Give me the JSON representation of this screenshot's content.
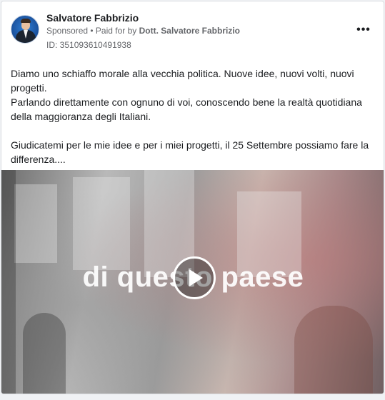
{
  "post": {
    "author": "Salvatore Fabbrizio",
    "sponsored": "Sponsored",
    "paid_for_prefix": " • Paid for by ",
    "paid_for_by": "Dott. Salvatore Fabbrizio",
    "ad_id": "ID: 351093610491938",
    "more_icon": "•••",
    "text_lines": [
      "Diamo uno schiaffo morale alla vecchia politica. Nuove idee, nuovi volti, nuovi progetti.",
      "Parlando direttamente con ognuno di voi, conoscendo bene la realtà quotidiana della maggioranza degli Italiani.",
      "Giudicatemi per le mie idee e per i miei progetti, il 25 Settembre possiamo fare la differenza...."
    ]
  },
  "video": {
    "overlay_text": "di questo paese",
    "play_icon": "play-icon"
  },
  "icons": [
    "more-options-icon",
    "play-icon"
  ],
  "colors": {
    "text": "#1c1e21",
    "secondary": "#65676b",
    "border": "#dadde1"
  }
}
